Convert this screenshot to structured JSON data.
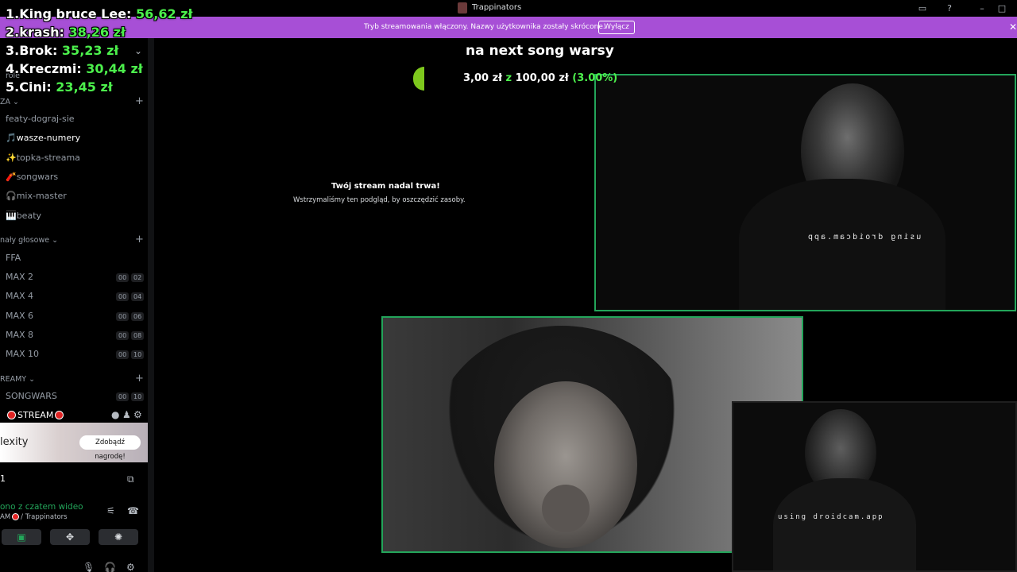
{
  "window": {
    "title": "Trappinators"
  },
  "banner": {
    "message": "Tryb streamowania włączony. Nazwy użytkownika zostały skrócone.",
    "button": "Wyłącz"
  },
  "donors": [
    {
      "rank": "1.",
      "name": "King bruce Lee:",
      "amount": "56,62 zł"
    },
    {
      "rank": "2.",
      "name": "krash:",
      "amount": "38,26 zł"
    },
    {
      "rank": "3.",
      "name": "Brok:",
      "amount": "35,23 zł"
    },
    {
      "rank": "4.",
      "name": "Kreczmi:",
      "amount": "30,44 zł"
    },
    {
      "rank": "5.",
      "name": "Cini:",
      "amount": "23,45 zł"
    }
  ],
  "goal": {
    "title": "na next song warsy",
    "current": "3,00 zł",
    "separator": "z",
    "target": "100,00 zł",
    "percent": "(3.00%)"
  },
  "sidebar": {
    "role_label": "role",
    "category_text": "ZA",
    "text_channels": [
      {
        "label": "featy-dograj-sie",
        "icon": ""
      },
      {
        "label": "wasze-numery",
        "icon": "🎵"
      },
      {
        "label": "topka-streama",
        "icon": "✨"
      },
      {
        "label": "songwars",
        "icon": "🧨"
      },
      {
        "label": "mix-master",
        "icon": "🎧"
      },
      {
        "label": "beaty",
        "icon": "🎹"
      }
    ],
    "category_voice": "nały głosowe",
    "voice_channels": [
      {
        "label": "FFA",
        "a": "",
        "b": ""
      },
      {
        "label": "MAX 2",
        "a": "00",
        "b": "02"
      },
      {
        "label": "MAX 4",
        "a": "00",
        "b": "04"
      },
      {
        "label": "MAX 6",
        "a": "00",
        "b": "06"
      },
      {
        "label": "MAX 8",
        "a": "00",
        "b": "08"
      },
      {
        "label": "MAX 10",
        "a": "00",
        "b": "10"
      }
    ],
    "category_streams": "REAMY",
    "stream_channels": [
      {
        "label": "SONGWARS",
        "a": "00",
        "b": "10"
      }
    ],
    "live_channel": "STREAM",
    "promo": {
      "name": "lexity",
      "button": "Zdobądź nagrodę!"
    },
    "user_number": "1",
    "voice_status": "ono z czatem wideo",
    "voice_sub_prefix": "AM",
    "voice_sub_server": "/ Trappinators"
  },
  "stream": {
    "paused_title": "Twój stream nadal trwa!",
    "paused_sub": "Wstrzymaliśmy ten podgląd, by oszczędzić zasoby."
  },
  "tiles": {
    "watermark_a": "using droidcam.app",
    "watermark_c": "using droidcam.app"
  },
  "colors": {
    "accent_green": "#23a55a",
    "banner_purple": "#a74fd6",
    "donor_amount": "#4cf04c"
  }
}
